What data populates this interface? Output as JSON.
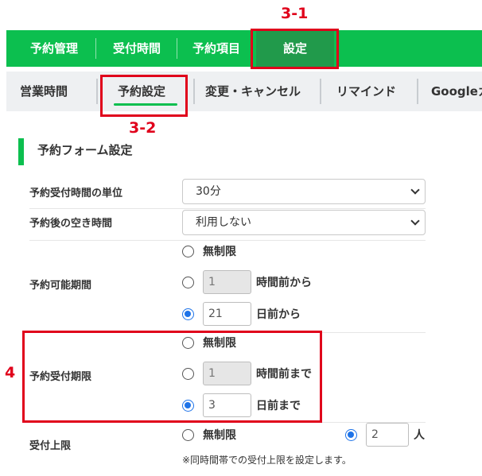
{
  "annotations": {
    "box1_label": "3-1",
    "box2_label": "3-2",
    "box4_label": "4"
  },
  "topnav": {
    "items": [
      "予約管理",
      "受付時間",
      "予約項目",
      "設定"
    ]
  },
  "subnav": {
    "tabs": [
      "営業時間",
      "予約設定",
      "変更・キャンセル",
      "リマインド",
      "Googleカ"
    ]
  },
  "section": {
    "title": "予約フォーム設定"
  },
  "form": {
    "unit": {
      "label": "予約受付時間の単位",
      "value": "30分"
    },
    "gap": {
      "label": "予約後の空き時間",
      "value": "利用しない"
    },
    "period": {
      "label": "予約可能期間",
      "unlimited": "無制限",
      "hours_value": "1",
      "hours_suffix": "時間前から",
      "days_value": "21",
      "days_suffix": "日前から"
    },
    "deadline": {
      "label": "予約受付期限",
      "unlimited": "無制限",
      "hours_value": "1",
      "hours_suffix": "時間前まで",
      "days_value": "3",
      "days_suffix": "日前まで"
    },
    "capacity": {
      "label": "受付上限",
      "unlimited": "無制限",
      "people_value": "2",
      "people_suffix": "人",
      "note": "※同時間帯での受付上限を設定します。"
    }
  },
  "colors": {
    "brand_green": "#0cbf4f",
    "active_green": "#219a4b",
    "annotation_red": "#e0001b",
    "radio_blue": "#1e73e8"
  }
}
